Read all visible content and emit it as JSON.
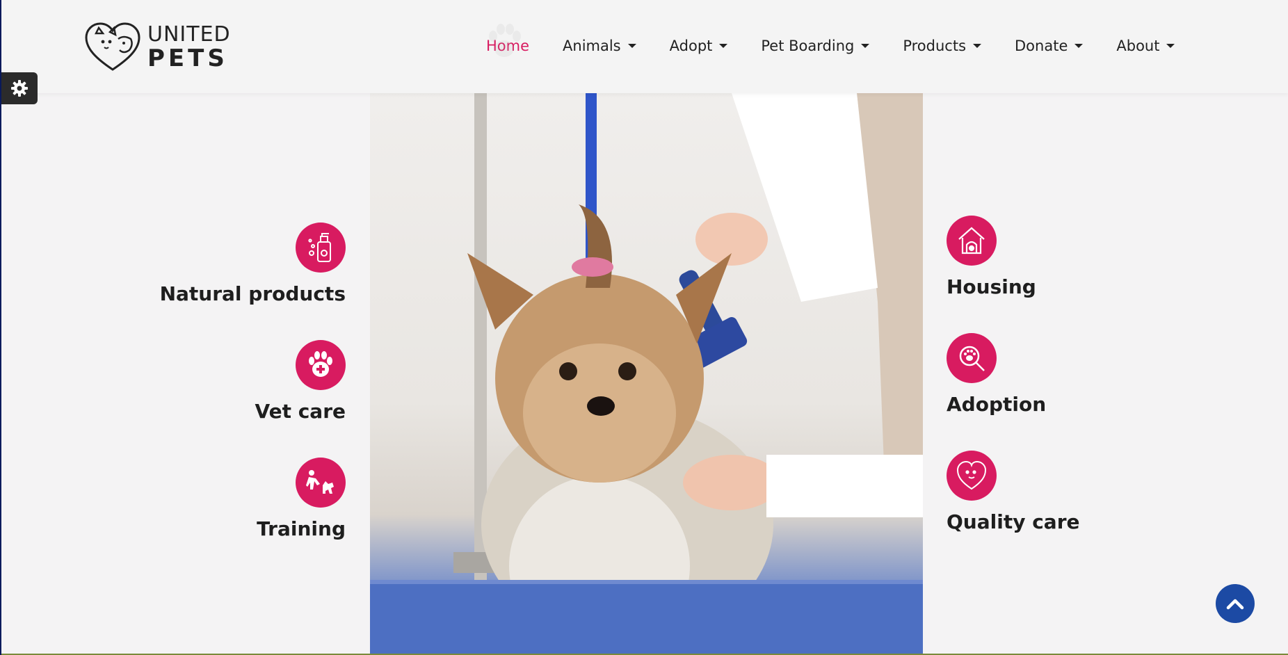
{
  "brand": {
    "line1": "UNITED",
    "line2": "PETS"
  },
  "nav": {
    "items": [
      {
        "label": "Home",
        "active": true,
        "dropdown": false
      },
      {
        "label": "Animals",
        "dropdown": true
      },
      {
        "label": "Adopt",
        "dropdown": true
      },
      {
        "label": "Pet Boarding",
        "dropdown": true
      },
      {
        "label": "Products",
        "dropdown": true
      },
      {
        "label": "Donate",
        "dropdown": true
      },
      {
        "label": "About",
        "dropdown": true
      }
    ]
  },
  "features": {
    "left": [
      {
        "label": "Natural products",
        "icon": "shampoo-bottle-icon"
      },
      {
        "label": "Vet care",
        "icon": "paw-medical-icon"
      },
      {
        "label": "Training",
        "icon": "dog-training-icon"
      }
    ],
    "right": [
      {
        "label": "Housing",
        "icon": "pet-house-icon"
      },
      {
        "label": "Adoption",
        "icon": "paw-search-icon"
      },
      {
        "label": "Quality care",
        "icon": "pet-heart-icon"
      }
    ]
  },
  "colors": {
    "accent": "#d81b60",
    "to_top": "#1c4aa4",
    "settings": "#2b2b2b"
  },
  "hero": {
    "image": "yorkshire-terrier-grooming-photo"
  }
}
